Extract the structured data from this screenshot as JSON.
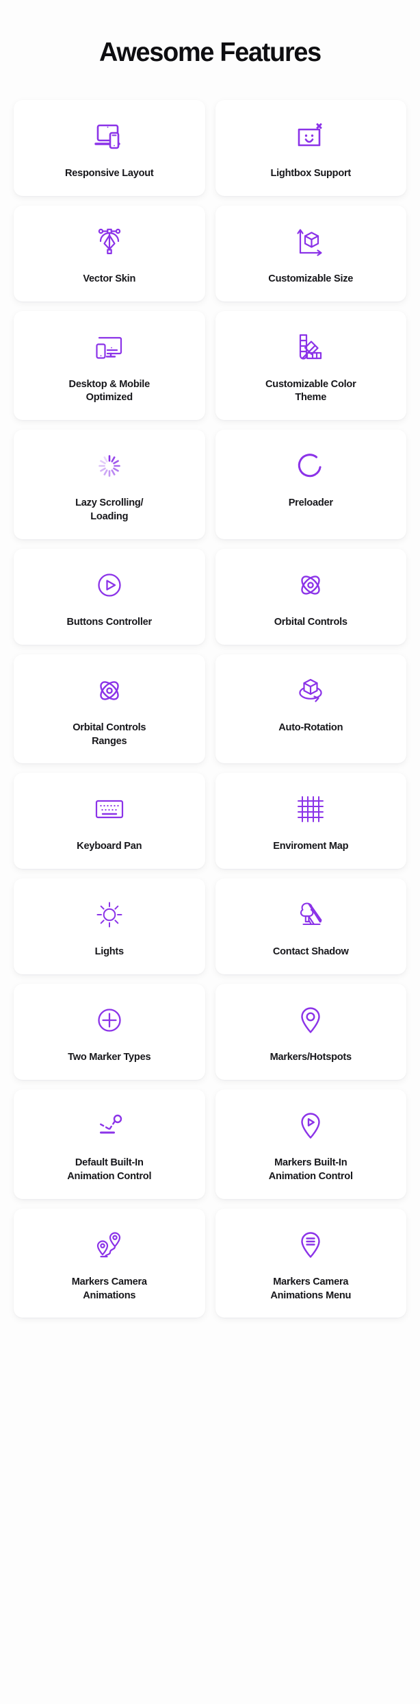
{
  "page": {
    "title": "Awesome Features",
    "background_color": "#fdfdfd",
    "accent_color": "#8B33E8",
    "card_background": "#ffffff",
    "text_color": "#17171b"
  },
  "features": [
    {
      "label": "Responsive Layout",
      "icon": "laptop-phone-icon"
    },
    {
      "label": "Lightbox Support",
      "icon": "lightbox-smiley-close-icon"
    },
    {
      "label": "Vector Skin",
      "icon": "pen-bezier-icon"
    },
    {
      "label": "Customizable Size",
      "icon": "cube-axes-icon"
    },
    {
      "label": "Desktop & Mobile\nOptimized",
      "icon": "monitor-phone-icon"
    },
    {
      "label": "Customizable Color\nTheme",
      "icon": "color-swatches-icon"
    },
    {
      "label": "Lazy Scrolling/\nLoading",
      "icon": "spinner-dots-icon"
    },
    {
      "label": "Preloader",
      "icon": "arc-spinner-icon"
    },
    {
      "label": "Buttons Controller",
      "icon": "play-circle-icon"
    },
    {
      "label": "Orbital Controls",
      "icon": "atom-orbit-icon"
    },
    {
      "label": "Orbital Controls\nRanges",
      "icon": "atom-orbit-icon"
    },
    {
      "label": "Auto-Rotation",
      "icon": "cube-rotate-icon"
    },
    {
      "label": "Keyboard Pan",
      "icon": "keyboard-icon"
    },
    {
      "label": "Enviroment Map",
      "icon": "grid-mesh-icon"
    },
    {
      "label": "Lights",
      "icon": "sun-icon"
    },
    {
      "label": "Contact Shadow",
      "icon": "tree-shadow-icon"
    },
    {
      "label": "Two Marker Types",
      "icon": "plus-circle-icon"
    },
    {
      "label": "Markers/Hotspots",
      "icon": "map-pin-icon"
    },
    {
      "label": "Default Built-In\nAnimation Control",
      "icon": "bounce-path-icon"
    },
    {
      "label": "Markers Built-In\nAnimation Control",
      "icon": "map-pin-play-icon"
    },
    {
      "label": "Markers Camera\nAnimations",
      "icon": "two-pins-path-icon"
    },
    {
      "label": "Markers Camera\nAnimations Menu",
      "icon": "map-pin-menu-icon"
    }
  ]
}
